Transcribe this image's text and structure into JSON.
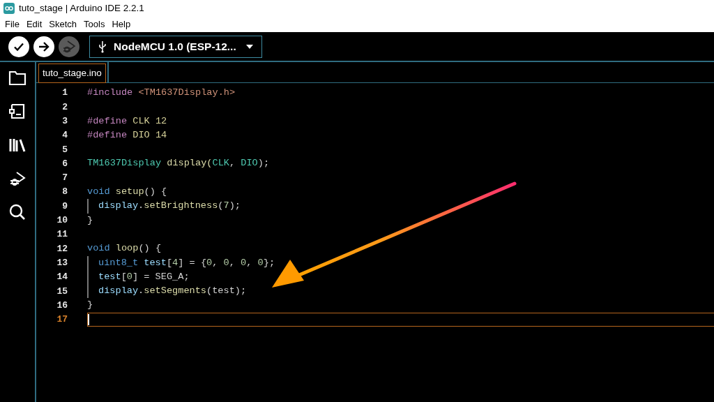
{
  "window": {
    "title": "tuto_stage | Arduino IDE 2.2.1"
  },
  "menu": [
    "File",
    "Edit",
    "Sketch",
    "Tools",
    "Help"
  ],
  "toolbar": {
    "board": "NodeMCU 1.0 (ESP-12...",
    "debug_disabled": true
  },
  "tabs": [
    {
      "label": "tuto_stage.ino",
      "selected": true
    }
  ],
  "editor": {
    "lines": [
      {
        "number": "1",
        "current": false,
        "guide": false,
        "tokens": [
          {
            "text": "#include",
            "kind": "directive"
          },
          {
            "text": " <TM1637Display.h>",
            "kind": "string"
          }
        ]
      },
      {
        "number": "2",
        "current": false,
        "guide": false
      },
      {
        "number": "3",
        "current": false,
        "guide": false,
        "tokens": [
          {
            "text": "#define",
            "kind": "directive"
          },
          {
            "text": " CLK 12",
            "kind": "macro"
          }
        ]
      },
      {
        "number": "4",
        "current": false,
        "guide": false,
        "tokens": [
          {
            "text": "#define",
            "kind": "directive"
          },
          {
            "text": " DIO 14",
            "kind": "macro"
          }
        ]
      },
      {
        "number": "5",
        "current": false,
        "guide": false
      },
      {
        "number": "6",
        "current": false,
        "guide": false,
        "tokens": [
          {
            "text": "TM1637Display",
            "kind": "type"
          },
          {
            "text": " display(",
            "kind": "func"
          },
          {
            "text": "CLK",
            "kind": "type"
          },
          {
            "text": ", ",
            "kind": "plain"
          },
          {
            "text": "DIO",
            "kind": "type"
          },
          {
            "text": ");",
            "kind": "plain"
          }
        ]
      },
      {
        "number": "7",
        "current": false,
        "guide": false
      },
      {
        "number": "8",
        "current": false,
        "guide": false,
        "tokens": [
          {
            "text": "void",
            "kind": "keyword"
          },
          {
            "text": " setup",
            "kind": "func"
          },
          {
            "text": "() {",
            "kind": "plain"
          }
        ]
      },
      {
        "number": "9",
        "current": false,
        "guide": true,
        "tokens": [
          {
            "text": "display",
            "kind": "variable"
          },
          {
            "text": ".",
            "kind": "plain"
          },
          {
            "text": "setBrightness",
            "kind": "func"
          },
          {
            "text": "(",
            "kind": "plain"
          },
          {
            "text": "7",
            "kind": "number"
          },
          {
            "text": ");",
            "kind": "plain"
          }
        ]
      },
      {
        "number": "10",
        "current": false,
        "guide": false,
        "tokens": [
          {
            "text": "}",
            "kind": "plain"
          }
        ]
      },
      {
        "number": "11",
        "current": false,
        "guide": false
      },
      {
        "number": "12",
        "current": false,
        "guide": false,
        "tokens": [
          {
            "text": "void",
            "kind": "keyword"
          },
          {
            "text": " loop",
            "kind": "func"
          },
          {
            "text": "() {",
            "kind": "plain"
          }
        ]
      },
      {
        "number": "13",
        "current": false,
        "guide": true,
        "tokens": [
          {
            "text": "uint8_t",
            "kind": "keyword"
          },
          {
            "text": " test",
            "kind": "variable"
          },
          {
            "text": "[",
            "kind": "plain"
          },
          {
            "text": "4",
            "kind": "number"
          },
          {
            "text": "] = {",
            "kind": "plain"
          },
          {
            "text": "0",
            "kind": "number"
          },
          {
            "text": ", ",
            "kind": "plain"
          },
          {
            "text": "0",
            "kind": "number"
          },
          {
            "text": ", ",
            "kind": "plain"
          },
          {
            "text": "0",
            "kind": "number"
          },
          {
            "text": ", ",
            "kind": "plain"
          },
          {
            "text": "0",
            "kind": "number"
          },
          {
            "text": "};",
            "kind": "plain"
          }
        ]
      },
      {
        "number": "14",
        "current": false,
        "guide": true,
        "tokens": [
          {
            "text": "test",
            "kind": "variable"
          },
          {
            "text": "[",
            "kind": "plain"
          },
          {
            "text": "0",
            "kind": "number"
          },
          {
            "text": "] = SEG_A;",
            "kind": "plain"
          }
        ]
      },
      {
        "number": "15",
        "current": false,
        "guide": true,
        "tokens": [
          {
            "text": "display",
            "kind": "variable"
          },
          {
            "text": ".",
            "kind": "plain"
          },
          {
            "text": "setSegments",
            "kind": "func"
          },
          {
            "text": "(test);",
            "kind": "plain"
          }
        ]
      },
      {
        "number": "16",
        "current": false,
        "guide": false,
        "tokens": [
          {
            "text": "}",
            "kind": "plain"
          }
        ]
      },
      {
        "number": "17",
        "current": true,
        "guide": false
      }
    ]
  }
}
